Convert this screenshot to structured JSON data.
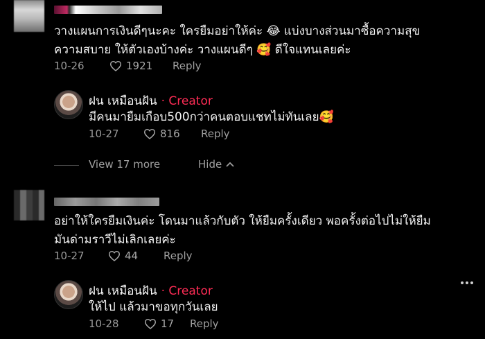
{
  "comments": [
    {
      "text_line1": "วางแผนการเงินดีๆนะคะ ใครยืมอย่าให้ค่ะ 😂 แบ่งบางส่วนมาซื้อความสุข",
      "text_line2": "ความสบาย ให้ตัวเองบ้างค่ะ วางแผนดีๆ 🥰 ดีใจแทนเลยค่ะ",
      "date": "10-26",
      "likes": "1921",
      "reply_label": "Reply",
      "reply": {
        "author": "ฝน เหมือนฝัน",
        "badge": "· Creator",
        "text": "มีคนมายืมเกือบ500กว่าคนตอบแชทไม่ทันเลย🥰",
        "date": "10-27",
        "likes": "816",
        "reply_label": "Reply"
      },
      "view_more": "View 17 more",
      "hide_label": "Hide"
    },
    {
      "text_line1": "อย่าให้ใครยืมเงินค่ะ โดนมาแล้วกับตัว ให้ยืมครั้งเดียว พอครั้งต่อไปไม่ให้ยืม",
      "text_line2": "มันด่ามราวีไม่เลิกเลยค่ะ",
      "date": "10-27",
      "likes": "44",
      "reply_label": "Reply",
      "reply": {
        "author": "ฝน เหมือนฝัน",
        "badge": "· Creator",
        "text": "ให้ไป แล้วมาขอทุกวันเลย",
        "date": "10-28",
        "likes": "17",
        "reply_label": "Reply"
      }
    }
  ],
  "icons": {
    "like": "heart-outline-icon",
    "hide": "chevron-up-icon",
    "more": "more-horizontal-icon"
  },
  "colors": {
    "background": "#000000",
    "creator_accent": "#fe2c55",
    "muted_text": "#9a9a9a"
  }
}
